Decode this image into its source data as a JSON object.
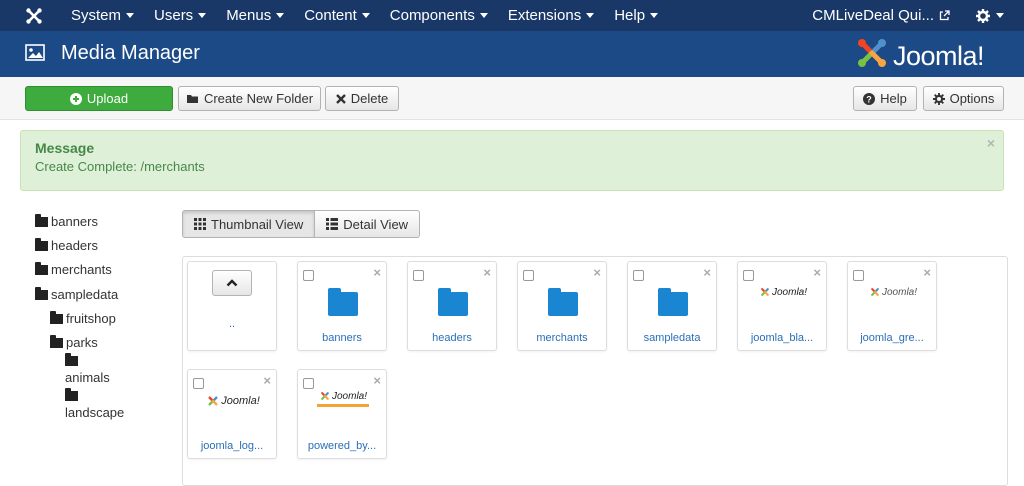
{
  "topnav": {
    "menu": [
      {
        "label": "System"
      },
      {
        "label": "Users"
      },
      {
        "label": "Menus"
      },
      {
        "label": "Content"
      },
      {
        "label": "Components"
      },
      {
        "label": "Extensions"
      },
      {
        "label": "Help"
      }
    ],
    "site_label": "CMLiveDeal Qui...",
    "icons": {
      "logo": "joomla-logo-icon",
      "external": "external-link-icon",
      "settings": "gear-icon"
    }
  },
  "header": {
    "title": "Media Manager",
    "brand": "Joomla!",
    "icon": "picture-icon"
  },
  "toolbar": {
    "upload": "Upload",
    "new_folder": "Create New Folder",
    "delete": "Delete",
    "help": "Help",
    "options": "Options"
  },
  "message": {
    "heading": "Message",
    "text": "Create Complete: /merchants",
    "close": "×"
  },
  "tree": [
    {
      "label": "banners"
    },
    {
      "label": "headers"
    },
    {
      "label": "merchants"
    },
    {
      "label": "sampledata"
    },
    {
      "label": "fruitshop"
    },
    {
      "label": "parks"
    },
    {
      "label": "animals"
    },
    {
      "label": "landscape"
    }
  ],
  "views": {
    "thumbnail": "Thumbnail View",
    "detail": "Detail View"
  },
  "items": [
    {
      "label": "..",
      "type": "up"
    },
    {
      "label": "banners",
      "type": "folder"
    },
    {
      "label": "headers",
      "type": "folder"
    },
    {
      "label": "merchants",
      "type": "folder"
    },
    {
      "label": "sampledata",
      "type": "folder"
    },
    {
      "label": "joomla_bla...",
      "type": "image"
    },
    {
      "label": "joomla_gre...",
      "type": "image"
    },
    {
      "label": "joomla_log...",
      "type": "image"
    },
    {
      "label": "powered_by...",
      "type": "image"
    }
  ],
  "thumb_text": "Joomla!",
  "colors": {
    "navbar": "#1a3867",
    "header": "#1c4a86",
    "success": "#3eab3e",
    "folder": "#1a85d1",
    "link": "#2a6fb7"
  }
}
